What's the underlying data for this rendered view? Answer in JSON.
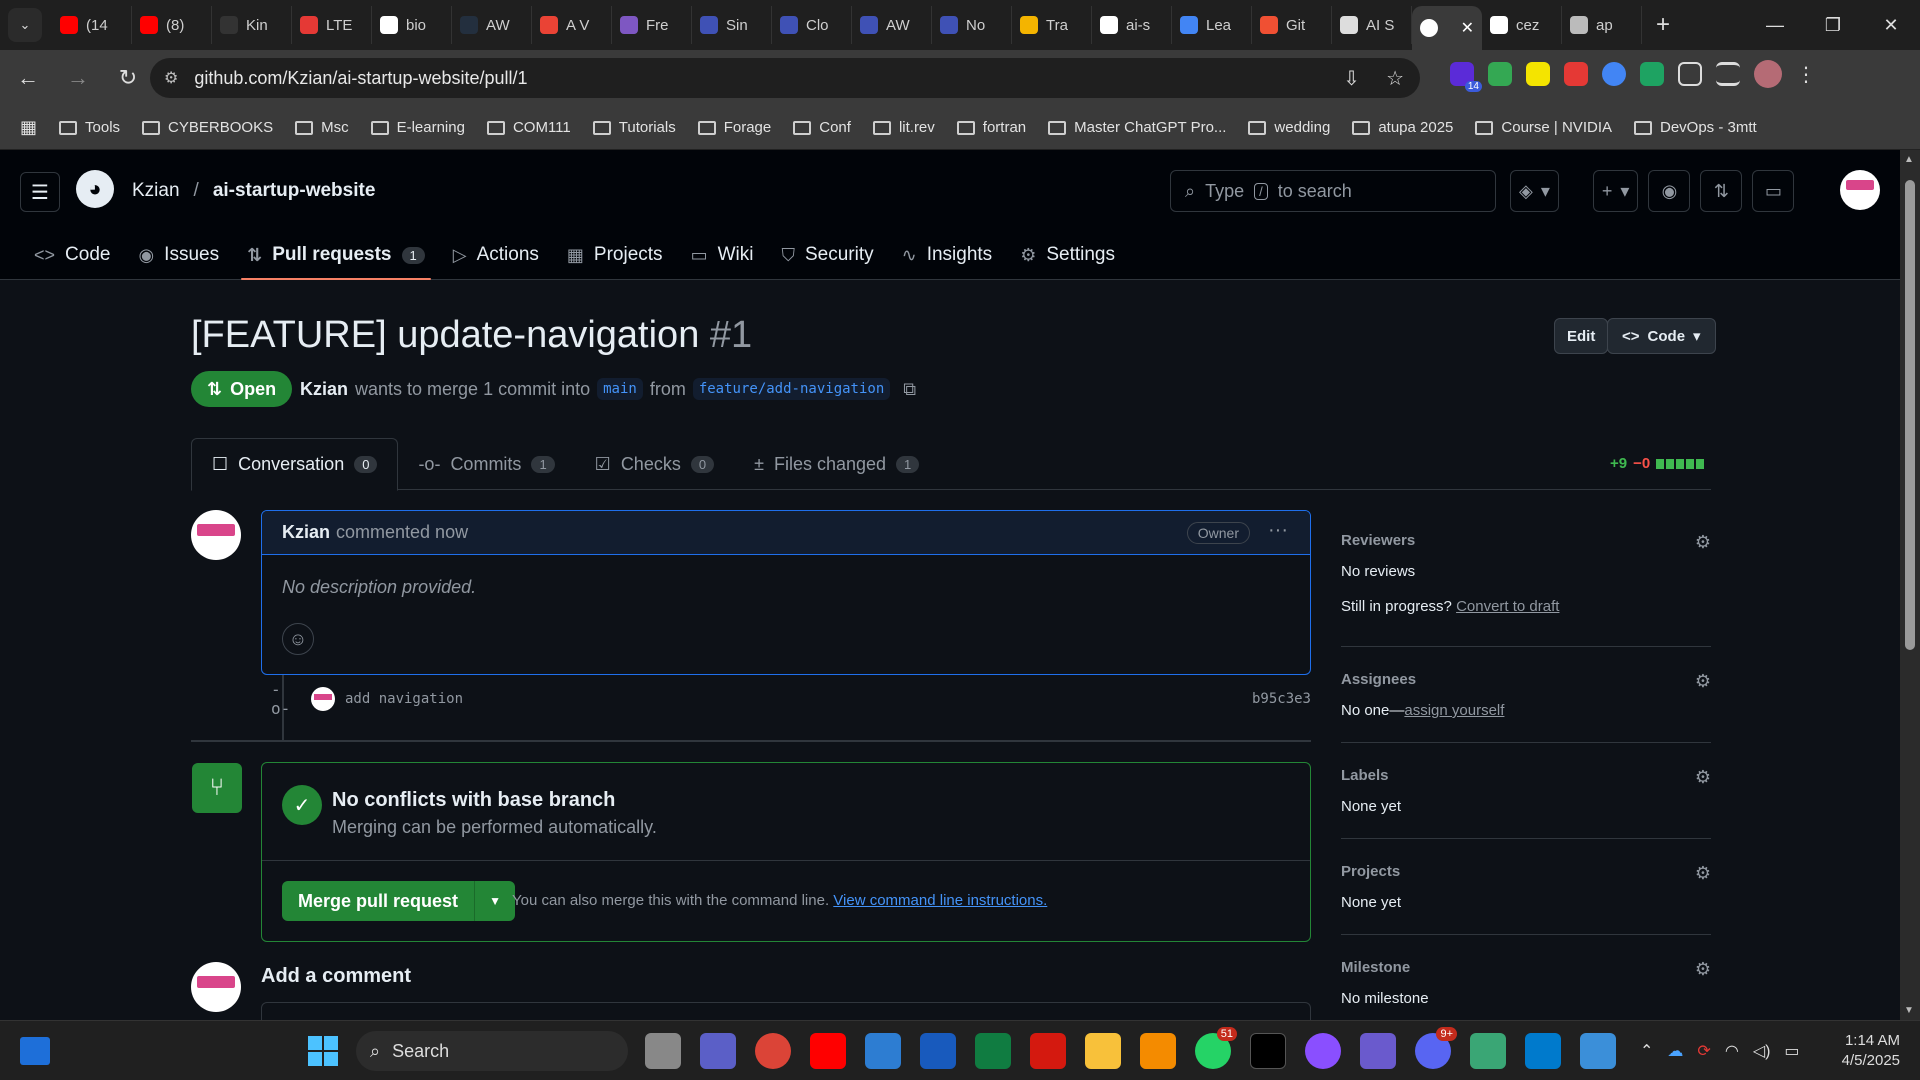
{
  "browser": {
    "tabs": [
      {
        "label": "(14",
        "color": "#ff0000"
      },
      {
        "label": "(8)",
        "color": "#ff0000"
      },
      {
        "label": "Kin",
        "color": "#333333"
      },
      {
        "label": "LTE",
        "color": "#e53935"
      },
      {
        "label": "bio",
        "color": "#ffffff"
      },
      {
        "label": "AW",
        "color": "#232f3e"
      },
      {
        "label": "A V",
        "color": "#ea4335"
      },
      {
        "label": "Fre",
        "color": "#7e57c2"
      },
      {
        "label": "Sin",
        "color": "#3f51b5"
      },
      {
        "label": "Clo",
        "color": "#3f51b5"
      },
      {
        "label": "AW",
        "color": "#3f51b5"
      },
      {
        "label": "No",
        "color": "#3f51b5"
      },
      {
        "label": "Tra",
        "color": "#f4b400"
      },
      {
        "label": "ai-s",
        "color": "#ffffff"
      },
      {
        "label": "Lea",
        "color": "#4285f4"
      },
      {
        "label": "Git",
        "color": "#f05033"
      },
      {
        "label": "AI S",
        "color": "#dddddd"
      }
    ],
    "active_tab_close": "✕",
    "tabs_after": [
      {
        "label": "cez",
        "color": "#ffffff"
      },
      {
        "label": "ap",
        "color": "#bbbbbb"
      }
    ],
    "url": "github.com/Kzian/ai-startup-website/pull/1",
    "bookmarks": [
      "Tools",
      "CYBERBOOKS",
      "Msc",
      "E-learning",
      "COM111",
      "Tutorials",
      "Forage",
      "Conf",
      "lit.rev",
      "fortran",
      "Master ChatGPT Pro...",
      "wedding",
      "atupa 2025",
      "Course | NVIDIA",
      "DevOps - 3mtt"
    ],
    "ext_badge": "14"
  },
  "repo": {
    "owner": "Kzian",
    "separator": "/",
    "name": "ai-startup-website",
    "search_placeholder_prefix": "Type",
    "search_key": "/",
    "search_placeholder_suffix": "to search",
    "tabs": [
      {
        "label": "Code",
        "icon": "<>"
      },
      {
        "label": "Issues",
        "icon": "◉"
      },
      {
        "label": "Pull requests",
        "icon": "⇅",
        "count": "1"
      },
      {
        "label": "Actions",
        "icon": "▷"
      },
      {
        "label": "Projects",
        "icon": "▦"
      },
      {
        "label": "Wiki",
        "icon": "▭"
      },
      {
        "label": "Security",
        "icon": "⛉"
      },
      {
        "label": "Insights",
        "icon": "∿"
      },
      {
        "label": "Settings",
        "icon": "⚙"
      }
    ]
  },
  "pr": {
    "title": "[FEATURE] update-navigation",
    "number": "#1",
    "edit_label": "Edit",
    "code_label": "Code",
    "state": "Open",
    "author": "Kzian",
    "meta_text": "wants to merge 1 commit into",
    "base": "main",
    "from_text": "from",
    "head": "feature/add-navigation",
    "tabs": [
      {
        "label": "Conversation",
        "count": "0"
      },
      {
        "label": "Commits",
        "count": "1"
      },
      {
        "label": "Checks",
        "count": "0"
      },
      {
        "label": "Files changed",
        "count": "1"
      }
    ],
    "additions": "+9",
    "deletions": "−0",
    "comment": {
      "author": "Kzian",
      "time": "commented now",
      "role": "Owner",
      "body": "No description provided."
    },
    "commit": {
      "message": "add navigation",
      "sha": "b95c3e3"
    },
    "merge": {
      "title": "No conflicts with base branch",
      "subtitle": "Merging can be performed automatically.",
      "button": "Merge pull request",
      "note": "You can also merge this with the command line.",
      "link": "View command line instructions."
    },
    "add_comment": "Add a comment"
  },
  "sidebar": {
    "reviewers_label": "Reviewers",
    "reviewers_value": "No reviews",
    "draft_prefix": "Still in progress?",
    "draft_link": "Convert to draft",
    "assignees_label": "Assignees",
    "assignees_prefix": "No one—",
    "assignees_link": "assign yourself",
    "labels_label": "Labels",
    "labels_value": "None yet",
    "projects_label": "Projects",
    "projects_value": "None yet",
    "milestone_label": "Milestone",
    "milestone_value": "No milestone"
  },
  "taskbar": {
    "search": "Search",
    "time": "1:14 AM",
    "date": "4/5/2025",
    "badges": {
      "whatsapp": "51",
      "discord": "9+"
    }
  }
}
